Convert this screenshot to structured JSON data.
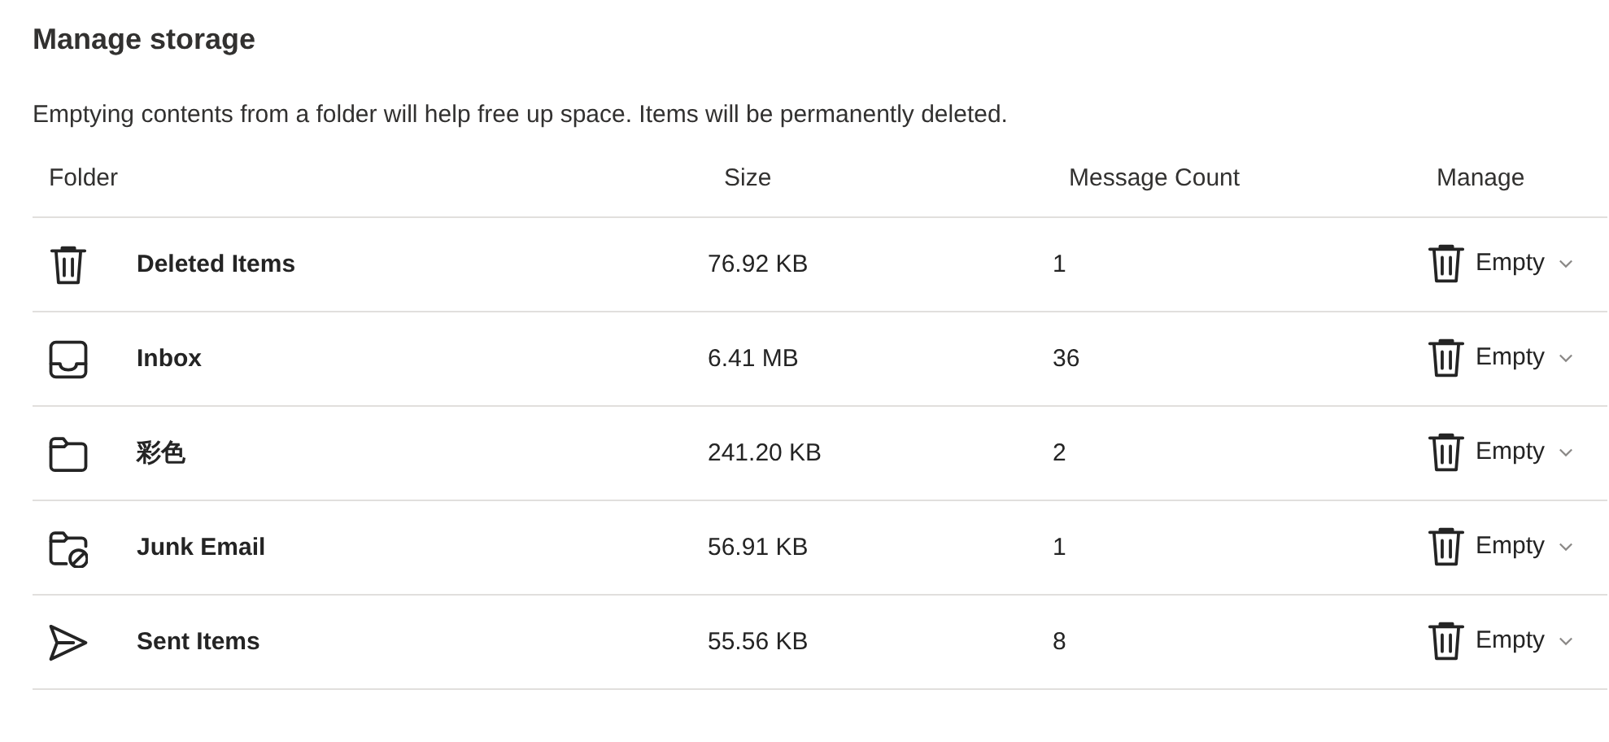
{
  "title": "Manage storage",
  "description": "Emptying contents from a folder will help free up space. Items will be permanently deleted.",
  "table": {
    "columns": [
      "Folder",
      "Size",
      "Message Count",
      "Manage"
    ],
    "rows": [
      {
        "kind": "deleted",
        "folder": "Deleted Items",
        "size": "76.92 KB",
        "count": "1",
        "action": "Empty"
      },
      {
        "kind": "inbox",
        "folder": "Inbox",
        "size": "6.41 MB",
        "count": "36",
        "action": "Empty"
      },
      {
        "kind": "folder",
        "folder": "彩色",
        "size": "241.20 KB",
        "count": "2",
        "action": "Empty"
      },
      {
        "kind": "junk",
        "folder": "Junk Email",
        "size": "56.91 KB",
        "count": "1",
        "action": "Empty"
      },
      {
        "kind": "sent",
        "folder": "Sent Items",
        "size": "55.56 KB",
        "count": "8",
        "action": "Empty"
      }
    ]
  }
}
